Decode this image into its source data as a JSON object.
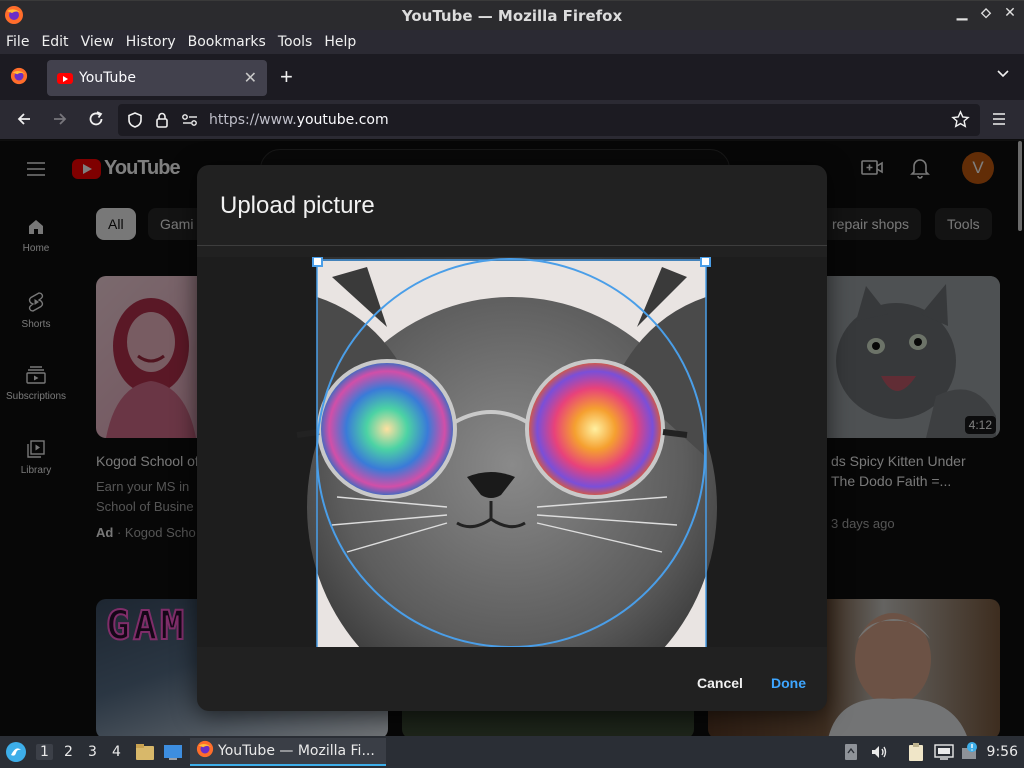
{
  "window": {
    "title": "YouTube — Mozilla Firefox",
    "controls": {
      "minimize": "▁",
      "restore": "⬦",
      "close": "✕"
    }
  },
  "menu": [
    "File",
    "Edit",
    "View",
    "History",
    "Bookmarks",
    "Tools",
    "Help"
  ],
  "tabs": [
    {
      "label": "YouTube",
      "close": "✕"
    }
  ],
  "newtab_label": "+",
  "address": {
    "prefix": "https://www.",
    "host": "youtube.com",
    "suffix": ""
  },
  "youtube": {
    "logo_text": "YouTube",
    "avatar_letter": "V",
    "sidebar": [
      {
        "label": "Home",
        "icon": "home-icon"
      },
      {
        "label": "Shorts",
        "icon": "shorts-icon"
      },
      {
        "label": "Subscriptions",
        "icon": "subscriptions-icon"
      },
      {
        "label": "Library",
        "icon": "library-icon"
      }
    ],
    "chips": [
      "All",
      "Gami",
      "repair shops",
      "Tools"
    ],
    "videos": [
      {
        "title": "Kogod School of",
        "meta1": "Earn your MS in",
        "meta2": "School of Busine",
        "ad_label": "Ad",
        "sponsor": "· Kogod Scho"
      },
      {
        "title": "ds Spicy Kitten Under",
        "title2": "The Dodo Faith =...",
        "meta": "3 days ago",
        "duration": "4:12"
      }
    ],
    "bottom_thumb_text": "GAM"
  },
  "dialog": {
    "title": "Upload picture",
    "cancel": "Cancel",
    "done": "Done"
  },
  "taskbar": {
    "workspaces": [
      "1",
      "2",
      "3",
      "4"
    ],
    "task_label": "YouTube — Mozilla Fi...",
    "clock": "9:56"
  },
  "colors": {
    "accent_blue": "#3ea6ff",
    "crop_blue": "#4a9ee8",
    "yt_red": "#ff0000",
    "avatar_bg": "#c45a0e"
  }
}
